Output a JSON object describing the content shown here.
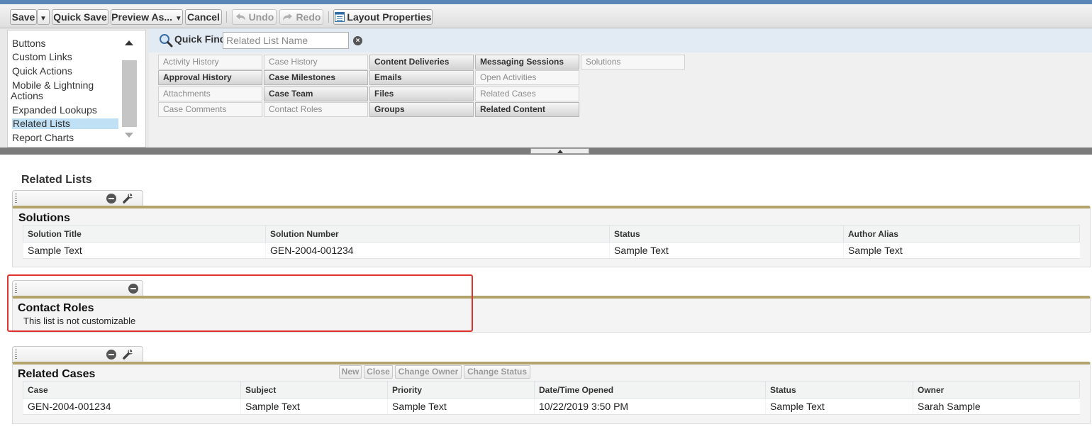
{
  "toolbar": {
    "save": "Save",
    "quick_save": "Quick Save",
    "preview_as": "Preview As...",
    "cancel": "Cancel",
    "undo": "Undo",
    "redo": "Redo",
    "layout_properties": "Layout Properties"
  },
  "palette": {
    "categories": [
      {
        "label": "Buttons"
      },
      {
        "label": "Custom Links"
      },
      {
        "label": "Quick Actions"
      },
      {
        "label": "Mobile & Lightning"
      },
      {
        "label": "Actions"
      },
      {
        "label": "Expanded Lookups"
      },
      {
        "label": "Related Lists",
        "active": true
      },
      {
        "label": "Report Charts"
      }
    ],
    "quick_find": {
      "label": "Quick Find",
      "placeholder": "Related List Name"
    },
    "items": [
      {
        "label": "Activity History",
        "used": false
      },
      {
        "label": "Approval History",
        "used": true
      },
      {
        "label": "Attachments",
        "used": false
      },
      {
        "label": "Case Comments",
        "used": false
      },
      {
        "label": "Case History",
        "used": false
      },
      {
        "label": "Case Milestones",
        "used": true
      },
      {
        "label": "Case Team",
        "used": true
      },
      {
        "label": "Contact Roles",
        "used": false
      },
      {
        "label": "Content Deliveries",
        "used": true
      },
      {
        "label": "Emails",
        "used": true
      },
      {
        "label": "Files",
        "used": true
      },
      {
        "label": "Groups",
        "used": true
      },
      {
        "label": "Messaging Sessions",
        "used": true
      },
      {
        "label": "Open Activities",
        "used": false
      },
      {
        "label": "Related Cases",
        "used": false
      },
      {
        "label": "Related Content",
        "used": true
      },
      {
        "label": "Solutions",
        "used": false
      }
    ]
  },
  "section_title": "Related Lists",
  "solutions": {
    "title": "Solutions",
    "columns": [
      "Solution Title",
      "Solution Number",
      "Status",
      "Author Alias"
    ],
    "rows": [
      [
        "Sample Text",
        "GEN-2004-001234",
        "Sample Text",
        "Sample Text"
      ]
    ]
  },
  "contact_roles": {
    "title": "Contact Roles",
    "note": "This list is not customizable"
  },
  "related_cases": {
    "title": "Related Cases",
    "buttons": [
      "New",
      "Close",
      "Change Owner",
      "Change Status"
    ],
    "columns": [
      "Case",
      "Subject",
      "Priority",
      "Date/Time Opened",
      "Status",
      "Owner"
    ],
    "rows": [
      [
        "GEN-2004-001234",
        "Sample Text",
        "Sample Text",
        "10/22/2019 3:50 PM",
        "Sample Text",
        "Sarah Sample"
      ]
    ]
  },
  "colors": {
    "panel_accent": "#b2a36b",
    "highlight": "#e0322d",
    "active_category": "#bfe0f5"
  }
}
